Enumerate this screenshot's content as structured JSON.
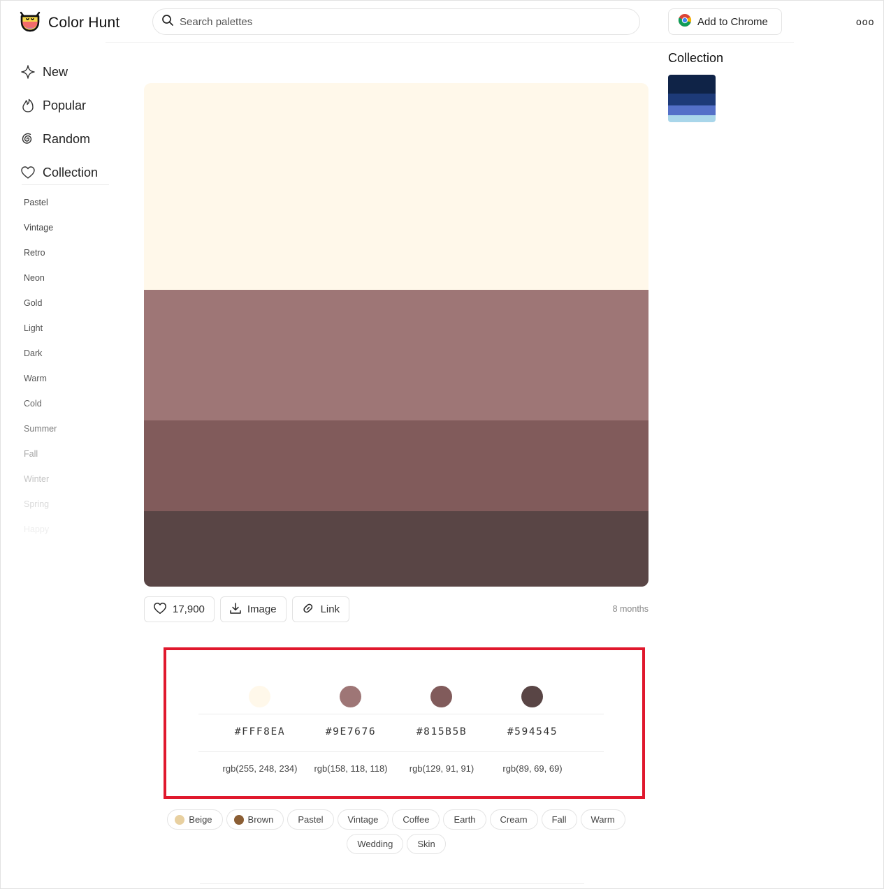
{
  "app": {
    "title": "Color Hunt"
  },
  "search": {
    "placeholder": "Search palettes"
  },
  "header": {
    "chrome_button": "Add to Chrome",
    "more_icon": "ooo"
  },
  "nav": [
    {
      "label": "New",
      "icon": "diamond-icon"
    },
    {
      "label": "Popular",
      "icon": "flame-icon"
    },
    {
      "label": "Random",
      "icon": "spiral-icon"
    },
    {
      "label": "Collection",
      "icon": "heart-icon"
    }
  ],
  "tags": [
    {
      "label": "Pastel",
      "color": "#444444"
    },
    {
      "label": "Vintage",
      "color": "#444444"
    },
    {
      "label": "Retro",
      "color": "#4a4a4a"
    },
    {
      "label": "Neon",
      "color": "#4a4a4a"
    },
    {
      "label": "Gold",
      "color": "#505050"
    },
    {
      "label": "Light",
      "color": "#555555"
    },
    {
      "label": "Dark",
      "color": "#555555"
    },
    {
      "label": "Warm",
      "color": "#5a5a5a"
    },
    {
      "label": "Cold",
      "color": "#636363"
    },
    {
      "label": "Summer",
      "color": "#7a7a7a"
    },
    {
      "label": "Fall",
      "color": "#a5a5a5"
    },
    {
      "label": "Winter",
      "color": "#c4c4c4"
    },
    {
      "label": "Spring",
      "color": "#dadada"
    },
    {
      "label": "Happy",
      "color": "#eeeeee"
    }
  ],
  "palette": {
    "colors": [
      "#FFF8EA",
      "#9E7676",
      "#815B5B",
      "#594545"
    ],
    "stripe_shares": [
      0.41,
      0.26,
      0.18,
      0.15
    ],
    "likes": "17,900",
    "image_label": "Image",
    "link_label": "Link",
    "age": "8 months"
  },
  "details": {
    "hex": [
      "#FFF8EA",
      "#9E7676",
      "#815B5B",
      "#594545"
    ],
    "rgb": [
      "rgb(255, 248, 234)",
      "rgb(158, 118, 118)",
      "rgb(129, 91, 91)",
      "rgb(89, 69, 69)"
    ]
  },
  "chips": [
    {
      "label": "Beige",
      "dot": "#e8d0a0"
    },
    {
      "label": "Brown",
      "dot": "#8b5e34"
    },
    {
      "label": "Pastel"
    },
    {
      "label": "Vintage"
    },
    {
      "label": "Coffee"
    },
    {
      "label": "Earth"
    },
    {
      "label": "Cream"
    },
    {
      "label": "Fall"
    },
    {
      "label": "Warm"
    },
    {
      "label": "Wedding"
    },
    {
      "label": "Skin"
    }
  ],
  "collection": {
    "title": "Collection",
    "colors": [
      "#0f2347",
      "#1d3a78",
      "#5470c8",
      "#a9d6ea"
    ],
    "shares": [
      0.4,
      0.25,
      0.2,
      0.15
    ]
  },
  "highlight_color": "#e0182d"
}
